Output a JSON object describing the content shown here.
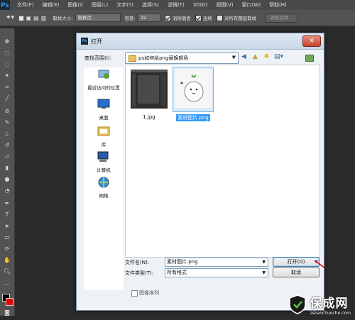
{
  "menubar": {
    "logo": "Ps",
    "items": [
      "文件(F)",
      "编辑(E)",
      "图像(I)",
      "图层(L)",
      "文字(Y)",
      "选择(S)",
      "滤镜(T)",
      "3D(D)",
      "视图(V)",
      "窗口(W)",
      "帮助(H)"
    ]
  },
  "options": {
    "sample_size_label": "取样大小:",
    "sample_size_value": "取样点",
    "tolerance_label": "容差:",
    "tolerance_value": "32",
    "antialias_label": "消除锯齿",
    "contiguous_label": "连续",
    "all_layers_label": "对所有图层取样",
    "refine_edge_label": "调整边缘..."
  },
  "dialog": {
    "title": "打开",
    "title_icon": "Ps",
    "close_label": "✕",
    "look_in_label": "查找范围(I):",
    "look_in_value": "ps如何给png替换颜色",
    "places": [
      {
        "label": "最近访问的位置",
        "icon": "recent-icon"
      },
      {
        "label": "桌面",
        "icon": "desktop-icon"
      },
      {
        "label": "库",
        "icon": "library-icon"
      },
      {
        "label": "计算机",
        "icon": "computer-icon"
      },
      {
        "label": "网络",
        "icon": "network-icon"
      }
    ],
    "files": [
      {
        "name": "1.jpg",
        "selected": false
      },
      {
        "name": "素材图片.png",
        "selected": true
      }
    ],
    "filename_label": "文件名(N):",
    "filename_value": "素材图片.png",
    "filetype_label": "文件类型(T):",
    "filetype_value": "所有格式",
    "open_label": "打开(O)",
    "cancel_label": "取消",
    "image_sequence_label": "图像序列"
  },
  "watermark": {
    "text": "保成网",
    "url": "zsbaochuoche.com"
  },
  "colors": {
    "foreground": "#000000",
    "background": "#e60000",
    "selection": "#3399ff",
    "arrow": "#d0021b"
  }
}
